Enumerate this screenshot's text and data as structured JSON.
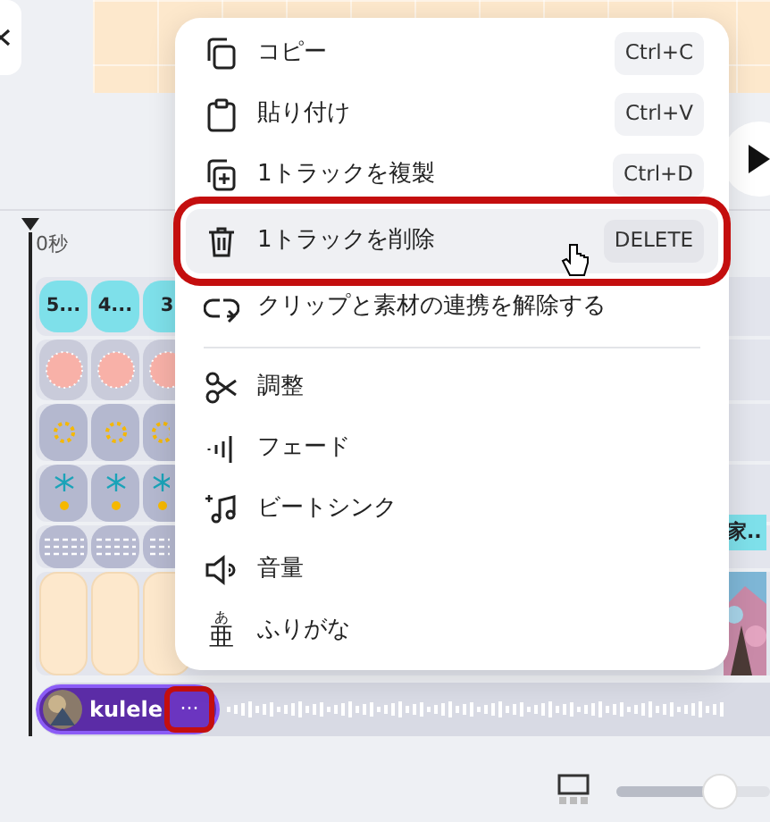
{
  "ruler": {
    "label": "0秒"
  },
  "tracks": [
    {
      "kind": "text",
      "clips": [
        "5...",
        "4...",
        "3"
      ]
    },
    {
      "kind": "circle"
    },
    {
      "kind": "sparkle"
    },
    {
      "kind": "snowflake"
    },
    {
      "kind": "dashes",
      "tail": "家.."
    },
    {
      "kind": "blank"
    }
  ],
  "audio": {
    "title": "kulele",
    "more_button": {
      "label": "···",
      "highlighted": true
    }
  },
  "zoom_slider": {
    "level": 0.67
  },
  "menu": {
    "groups": [
      [
        {
          "label": "コピー",
          "shortcut": "Ctrl+C",
          "selected": false
        },
        {
          "label": "貼り付け",
          "shortcut": "Ctrl+V",
          "selected": false
        },
        {
          "label": "1トラックを複製",
          "shortcut": "Ctrl+D",
          "selected": false
        },
        {
          "label": "1トラックを削除",
          "shortcut": "DELETE",
          "selected": true
        },
        {
          "label": "クリップと素材の連携を解除する",
          "selected": false
        }
      ],
      [
        {
          "label": "調整",
          "selected": false
        },
        {
          "label": "フェード",
          "selected": false
        },
        {
          "label": "ビートシンク",
          "selected": false
        },
        {
          "label": "音量",
          "selected": false
        },
        {
          "label": "ふりがな",
          "selected": false,
          "icon_ruby": "あ",
          "icon_glyph": "亜"
        }
      ]
    ]
  }
}
